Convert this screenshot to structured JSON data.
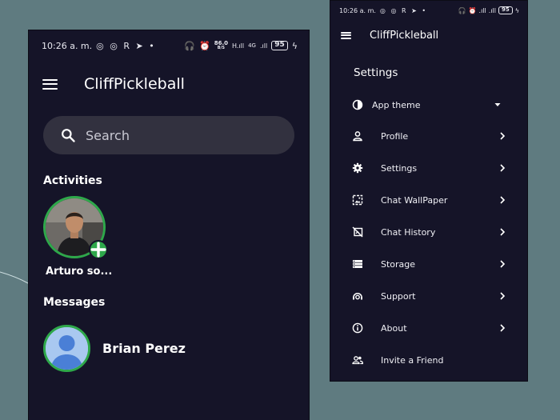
{
  "status_bar": {
    "time": "10:26 a. m.",
    "notification_icons": "◎ ◎ R ➤ •",
    "network_speed": "86.0",
    "network_speed_unit": "B/S",
    "network_type": "4G",
    "battery": "95"
  },
  "app": {
    "title": "CliffPickleball"
  },
  "search": {
    "placeholder": "Search"
  },
  "activities": {
    "title": "Activities",
    "items": [
      {
        "name": "Arturo so..."
      }
    ]
  },
  "messages": {
    "title": "Messages",
    "items": [
      {
        "name": "Brian Perez"
      }
    ]
  },
  "settings_menu": {
    "title": "Settings",
    "theme_label": "App theme",
    "items": [
      {
        "label": "Profile",
        "icon": "person-icon"
      },
      {
        "label": "Settings",
        "icon": "gear-icon"
      },
      {
        "label": "Chat WallPaper",
        "icon": "wallpaper-icon"
      },
      {
        "label": "Chat History",
        "icon": "history-icon"
      },
      {
        "label": "Storage",
        "icon": "storage-icon"
      },
      {
        "label": "Support",
        "icon": "support-icon"
      },
      {
        "label": "About",
        "icon": "info-icon"
      },
      {
        "label": "Invite a Friend",
        "icon": "people-icon"
      }
    ]
  },
  "colors": {
    "background": "#5f7b80",
    "panel": "#151428",
    "search_field": "#32313f",
    "accent_green": "#2ea84a"
  }
}
